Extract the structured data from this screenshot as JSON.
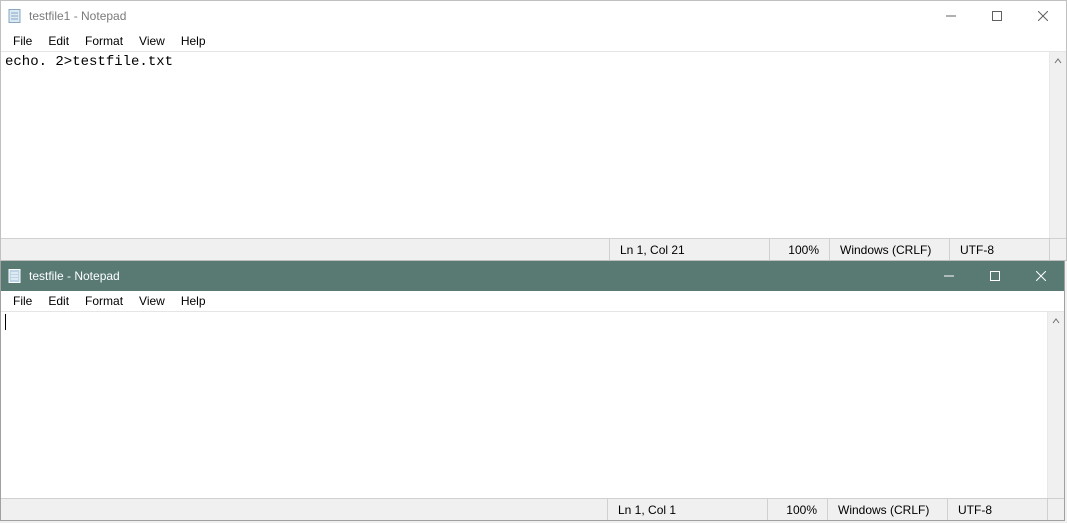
{
  "window1": {
    "title": "testfile1 - Notepad",
    "menus": {
      "file": "File",
      "edit": "Edit",
      "format": "Format",
      "view": "View",
      "help": "Help"
    },
    "content": "echo. 2>testfile.txt",
    "status": {
      "pos": "Ln 1, Col 21",
      "zoom": "100%",
      "eol": "Windows (CRLF)",
      "enc": "UTF-8"
    }
  },
  "window2": {
    "title": "testfile - Notepad",
    "menus": {
      "file": "File",
      "edit": "Edit",
      "format": "Format",
      "view": "View",
      "help": "Help"
    },
    "content": "",
    "status": {
      "pos": "Ln 1, Col 1",
      "zoom": "100%",
      "eol": "Windows (CRLF)",
      "enc": "UTF-8"
    }
  }
}
